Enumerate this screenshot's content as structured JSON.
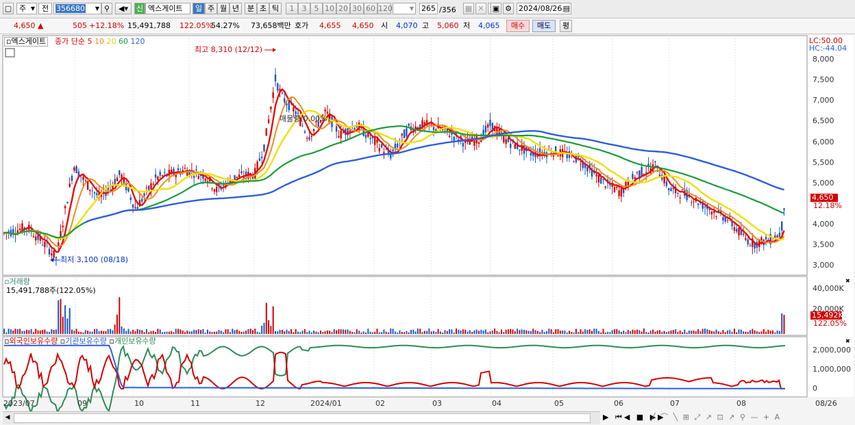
{
  "toolbar": {
    "market": "주",
    "type": "전",
    "code": "356680",
    "badge": "신",
    "name": "엑스게이트",
    "periods": [
      "일",
      "주",
      "월",
      "년",
      "분",
      "초",
      "틱"
    ],
    "selected_period": "일",
    "minutes": [
      "1",
      "3",
      "5",
      "10",
      "20",
      "30",
      "60",
      "120"
    ],
    "count": "265",
    "total": "/356",
    "date": "2024/08/26"
  },
  "quote": {
    "price": "4,650",
    "change": "505",
    "rate": "+12.18%",
    "volume": "15,491,788",
    "vol_ratio": "122.05%",
    "turnover": "54.27%",
    "amount": "73,658백만",
    "ask_label": "호가",
    "ask": "4,655",
    "bid": "4,650",
    "open_label": "시",
    "open": "4,070",
    "high_label": "고",
    "high": "5,060",
    "low_label": "저",
    "low": "4,065",
    "buy": "매수",
    "sell": "매도",
    "eval": "평"
  },
  "price_panel": {
    "stock": "엑스게이트",
    "ma_label": "종가 단순",
    "ma_periods": [
      "5",
      "10",
      "20",
      "60",
      "120"
    ],
    "ma_colors": [
      "#e01010",
      "#f08c1e",
      "#f0e000",
      "#1c9a3c",
      "#2d5fd8"
    ],
    "lc": "LC:50.00",
    "hc": "HC:-44.04",
    "high_note": "최고 8,310 (12/12)",
    "low_note": "최저 3,100 (08/18)",
    "mid_note": "매물량(0.00%)",
    "yticks": [
      "8,000",
      "7,500",
      "7,000",
      "6,500",
      "6,000",
      "5,500",
      "5,000",
      "4,500",
      "4,000",
      "3,500",
      "3,000"
    ],
    "last_price": "4,650",
    "last_rate": "12.18%"
  },
  "volume_panel": {
    "title": "거래량",
    "value": "15,491,788주(122.05%)",
    "yticks": [
      "40,000K",
      "20,000K"
    ],
    "last_value": "15,492K",
    "last_rate": "122.05%"
  },
  "holding_panel": {
    "series": [
      "외국인보유수량",
      "기관보유수량",
      "개인보유수량"
    ],
    "colors": [
      "#d40000",
      "#2d5fd8",
      "#2e8b57"
    ],
    "yticks": [
      "2,000,000",
      "1,000,000",
      "0"
    ]
  },
  "xaxis": [
    "2023/07",
    "09",
    "10",
    "11",
    "12",
    "2024/01",
    "02",
    "03",
    "04",
    "05",
    "06",
    "07",
    "08",
    "08/26"
  ]
}
